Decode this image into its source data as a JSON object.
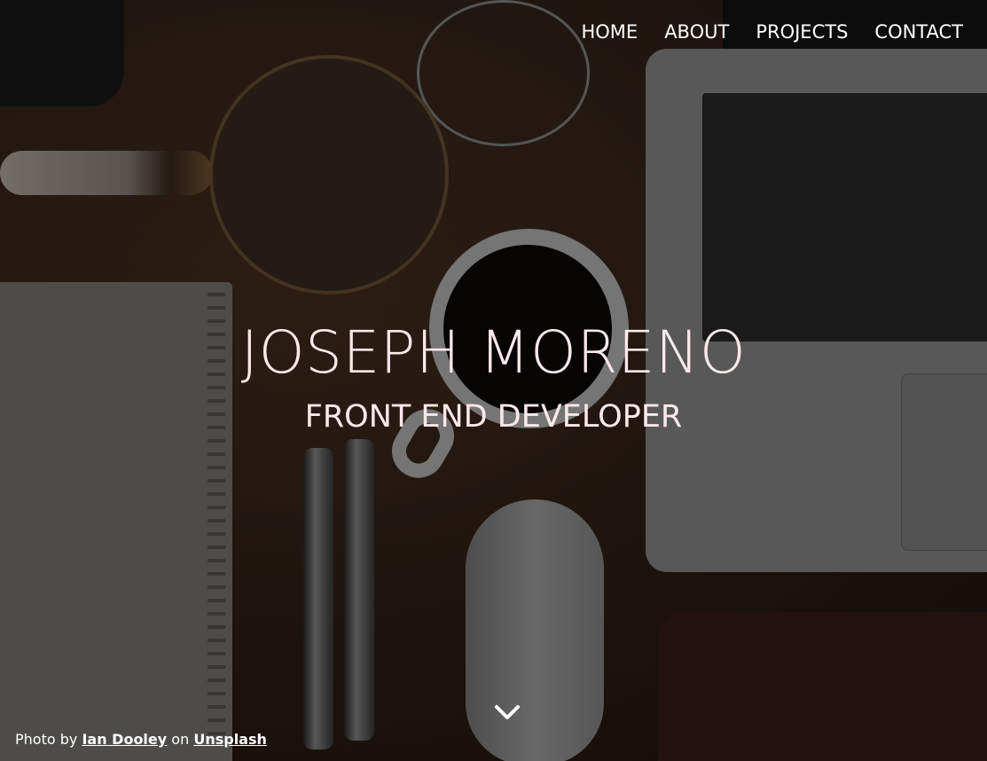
{
  "nav": {
    "items": [
      {
        "label": "HOME"
      },
      {
        "label": "ABOUT"
      },
      {
        "label": "PROJECTS"
      },
      {
        "label": "CONTACT"
      }
    ]
  },
  "hero": {
    "name": "JOSEPH MORENO",
    "role": "FRONT END DEVELOPER",
    "scroll_icon": "chevron-down-icon"
  },
  "credit": {
    "prefix": "Photo by",
    "photographer": "Ian Dooley",
    "middle": "on",
    "source": "Unsplash"
  },
  "colors": {
    "heading_text": "#fde9ea",
    "nav_text": "#ffffff"
  }
}
